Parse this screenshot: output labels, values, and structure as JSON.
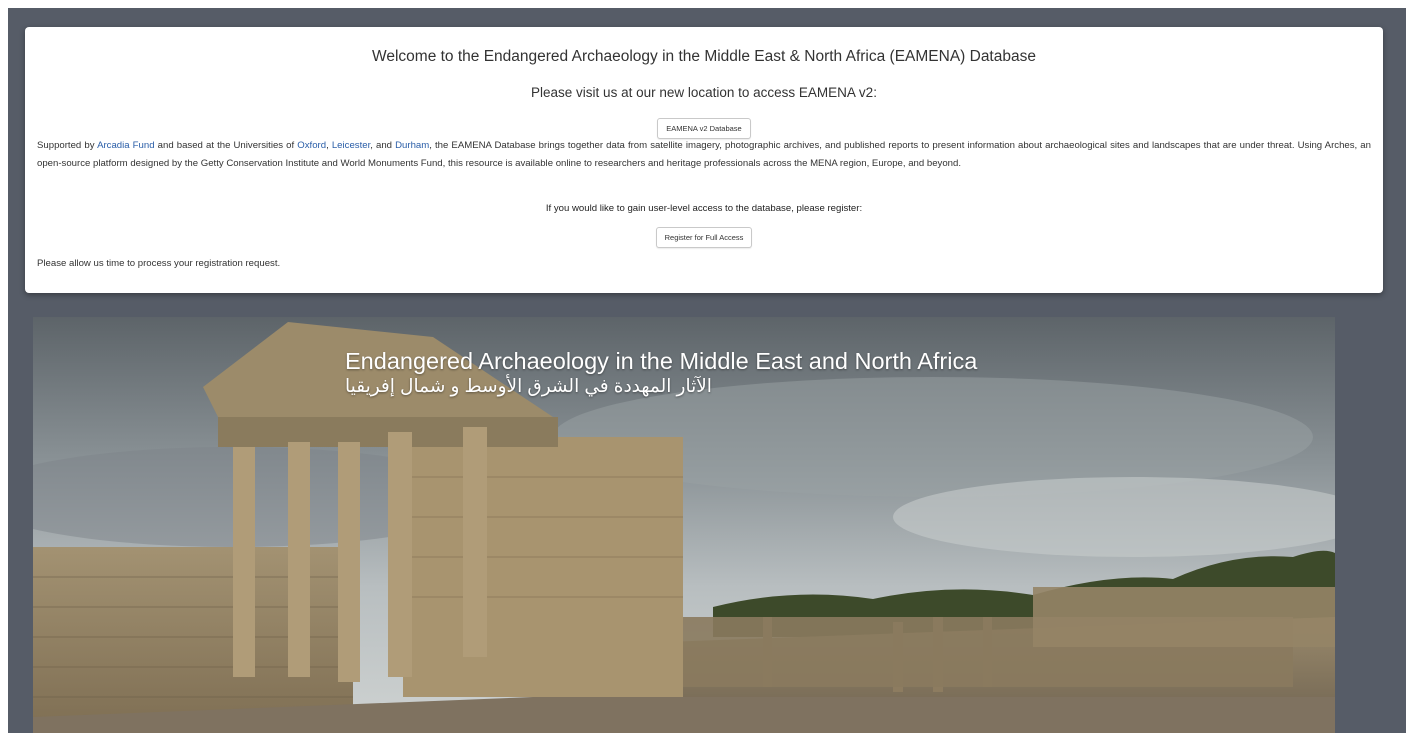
{
  "welcome": {
    "title": "Welcome to the Endangered Archaeology in the Middle East & North Africa (EAMENA) Database",
    "subtitle": "Please visit us at our new location to access EAMENA v2:",
    "v2_button": "EAMENA v2 Database",
    "description": {
      "p1": "Supported by ",
      "link_arcadia": "Arcadia Fund",
      "p2": " and based at the Universities of ",
      "link_oxford": "Oxford",
      "p3": ", ",
      "link_leicester": "Leicester",
      "p4": ", and ",
      "link_durham": "Durham",
      "p5": ", the EAMENA Database brings together data from satellite imagery, photographic archives, and published reports to present information about archaeological sites and landscapes that are under threat. Using Arches, an open-source platform designed by the Getty Conservation Institute and World Monuments Fund, this resource is available online to researchers and heritage professionals across the MENA region, Europe, and beyond."
    },
    "register_prompt": "If you would like to gain user-level access to the database, please register:",
    "register_button": "Register for Full Access",
    "allow_note": "Please allow us time to process your registration request."
  },
  "hero": {
    "title_en": "Endangered Archaeology in the Middle East and North Africa",
    "title_ar": "الآثار المهددة في الشرق الأوسط و شمال إفريقيا"
  },
  "colors": {
    "background": "#565c67",
    "link": "#2a5ea8",
    "card": "#ffffff"
  }
}
